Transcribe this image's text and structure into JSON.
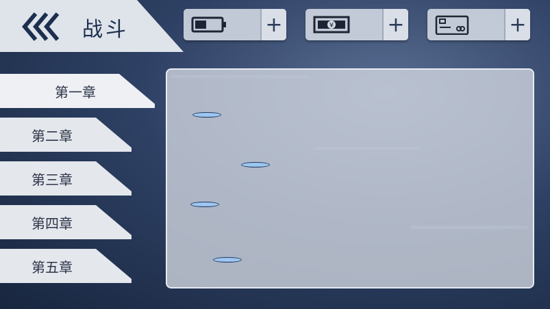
{
  "header": {
    "title": "战斗",
    "back_icon": "triple-chevron-left-icon"
  },
  "resources": [
    {
      "name": "energy",
      "icon": "battery-icon",
      "plus": "+"
    },
    {
      "name": "money",
      "icon": "banknote-yen-icon",
      "plus": "+"
    },
    {
      "name": "card",
      "icon": "credit-card-icon",
      "plus": "+"
    }
  ],
  "chapters": [
    {
      "label": "第一章"
    },
    {
      "label": "第二章"
    },
    {
      "label": "第三章"
    },
    {
      "label": "第四章"
    },
    {
      "label": "第五章"
    }
  ],
  "selected_chapter": "第一章",
  "colors": {
    "node_top": "#9ec6ee",
    "node_side": "#2f78c8",
    "title_text": "#1c2f4f"
  }
}
